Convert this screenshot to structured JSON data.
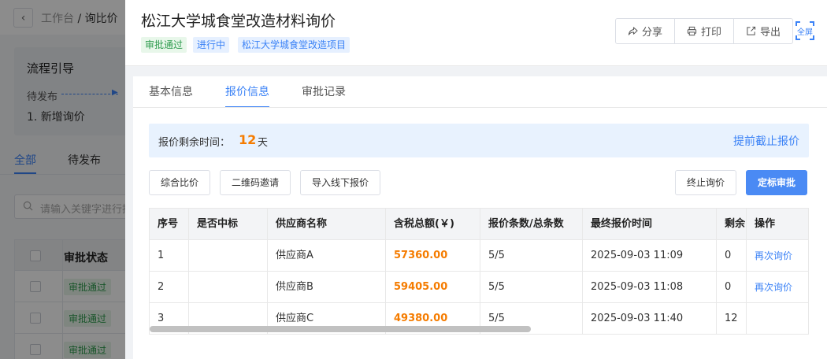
{
  "background": {
    "breadcrumb": {
      "root": "工作台",
      "current": "询比价"
    },
    "guide": {
      "title": "流程引导",
      "step": "待发布",
      "item": "1. 新增询价"
    },
    "tabs": [
      "全部",
      "待发布"
    ],
    "search_placeholder": "请输入关键字进行搜",
    "table": {
      "header": "审批状态",
      "badges": [
        "审批通过",
        "审批通过",
        "审批通过"
      ]
    }
  },
  "drawer": {
    "title": "松江大学城食堂改造材料询价",
    "tags": {
      "approval": "审批通过",
      "status": "进行中",
      "project": "松江大学城食堂改造项目"
    },
    "actions": {
      "share": "分享",
      "print": "打印",
      "export": "导出"
    },
    "fullscreen_label": "全屏",
    "tabs": [
      "基本信息",
      "报价信息",
      "审批记录"
    ],
    "countdown": {
      "label": "报价剩余时间：",
      "value": "12",
      "unit": "天",
      "link": "提前截止报价"
    },
    "buttons": {
      "compare": "综合比价",
      "qr_invite": "二维码邀请",
      "import_offline": "导入线下报价",
      "terminate": "终止询价",
      "award": "定标审批"
    },
    "table": {
      "columns": [
        "序号",
        "是否中标",
        "供应商名称",
        "含税总额(￥)",
        "报价条数/总条数",
        "最终报价时间",
        "剩余",
        "操作"
      ],
      "rows": [
        {
          "no": "1",
          "won": "",
          "supplier": "供应商A",
          "amount": "57360.00",
          "count": "5/5",
          "time": "2025-09-03 11:09",
          "remain": "0",
          "op": "再次询价"
        },
        {
          "no": "2",
          "won": "",
          "supplier": "供应商B",
          "amount": "59405.00",
          "count": "5/5",
          "time": "2025-09-03 11:08",
          "remain": "0",
          "op": "再次询价"
        },
        {
          "no": "3",
          "won": "",
          "supplier": "供应商C",
          "amount": "49380.00",
          "count": "5/5",
          "time": "2025-09-03 11:40",
          "remain": "12",
          "op": ""
        }
      ]
    }
  }
}
